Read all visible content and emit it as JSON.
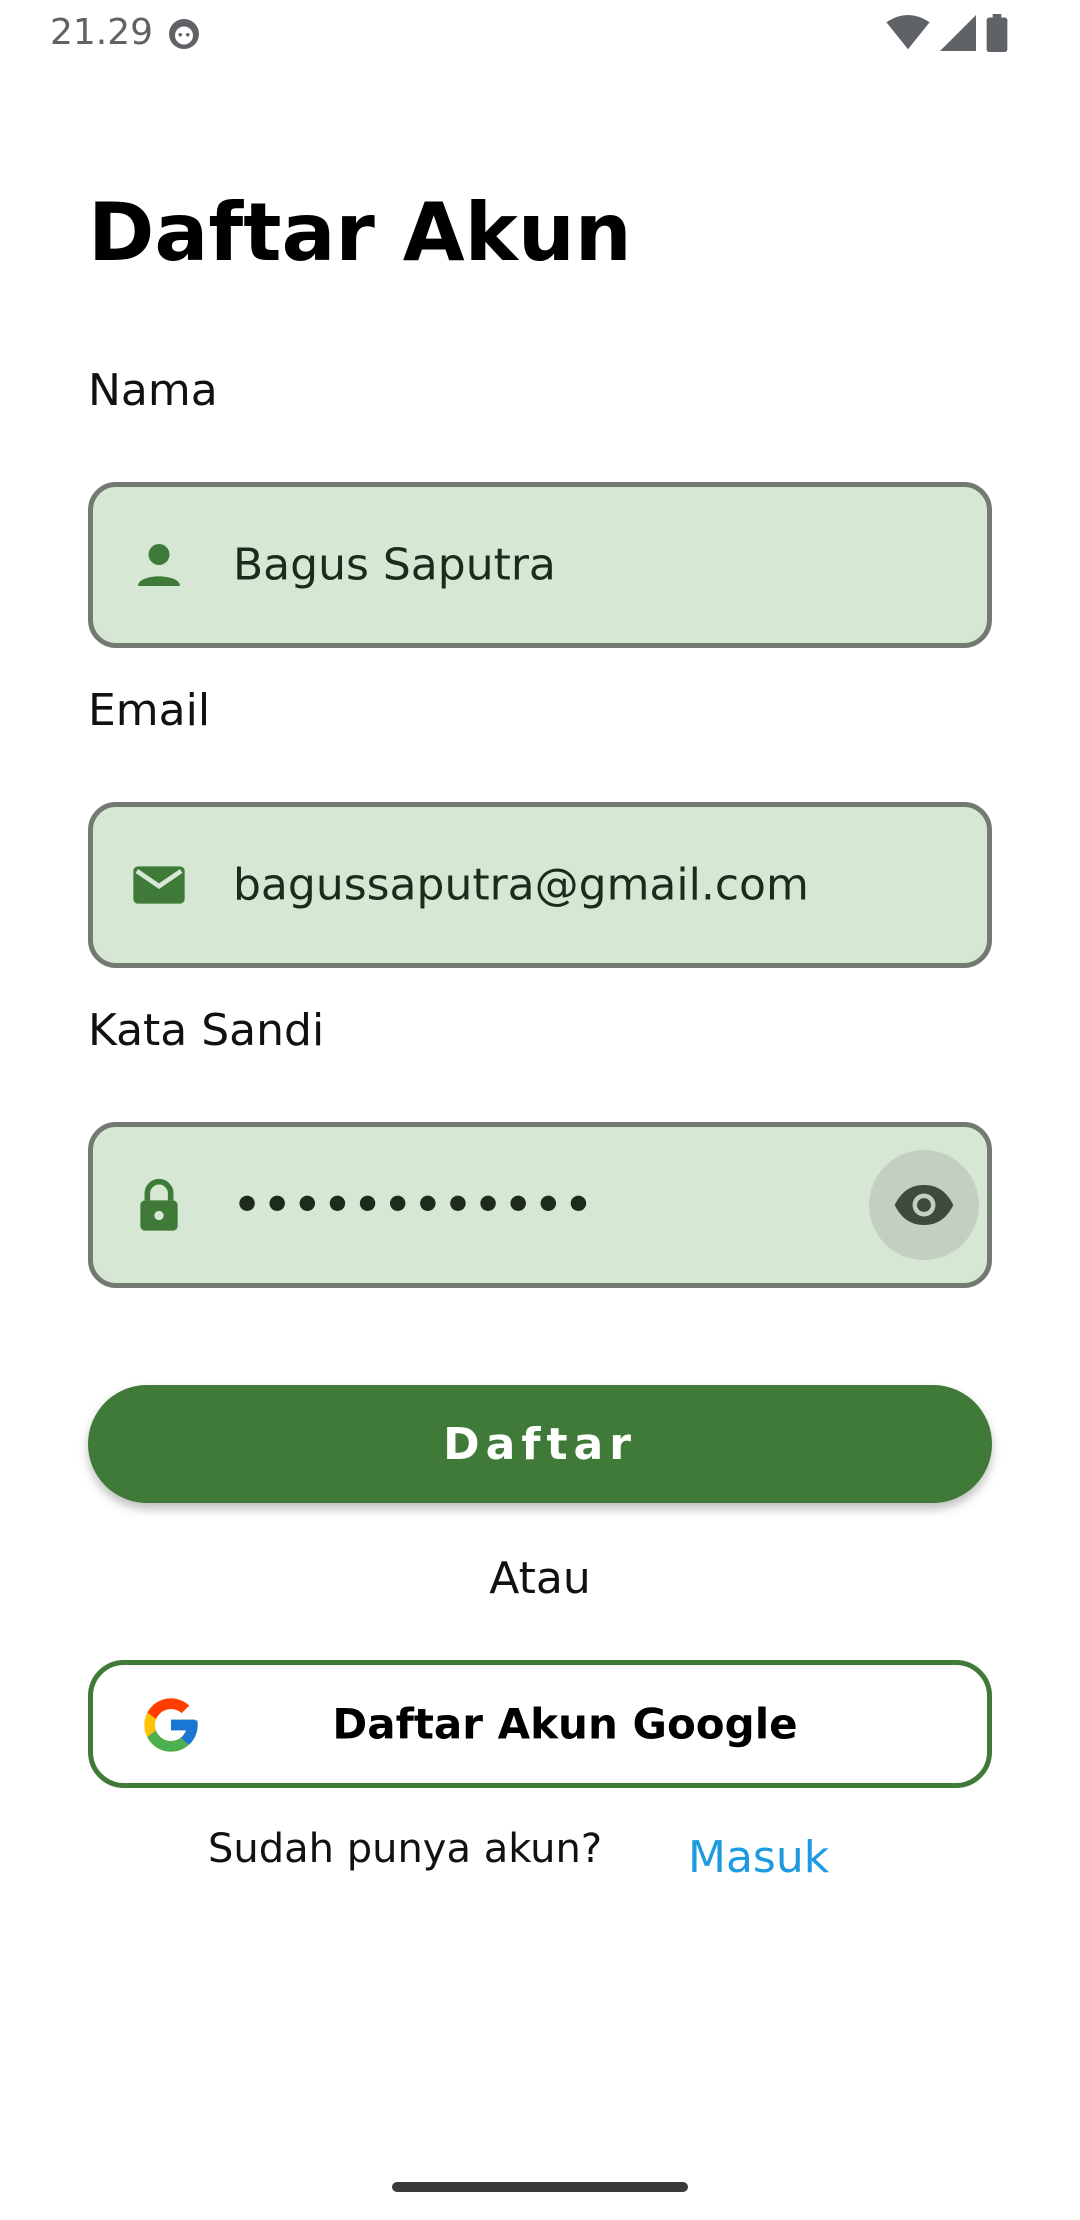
{
  "status_bar": {
    "time": "21.29"
  },
  "page": {
    "title": "Daftar Akun"
  },
  "form": {
    "name": {
      "label": "Nama",
      "value": "Bagus Saputra",
      "icon": "person-icon"
    },
    "email": {
      "label": "Email",
      "value": "bagussaputra@gmail.com",
      "icon": "mail-icon"
    },
    "password": {
      "label": "Kata Sandi",
      "masked_value": "••••••••••••",
      "icon": "lock-icon",
      "toggle_icon": "eye-icon"
    }
  },
  "actions": {
    "register_label": "Daftar",
    "divider_text": "Atau",
    "google_label": "Daftar Akun Google",
    "have_account_text": "Sudah punya akun?",
    "login_link": "Masuk"
  },
  "colors": {
    "primary": "#3f7a39",
    "field_bg": "#d6e8d4",
    "field_border": "#737a72",
    "link": "#1e9be0"
  }
}
